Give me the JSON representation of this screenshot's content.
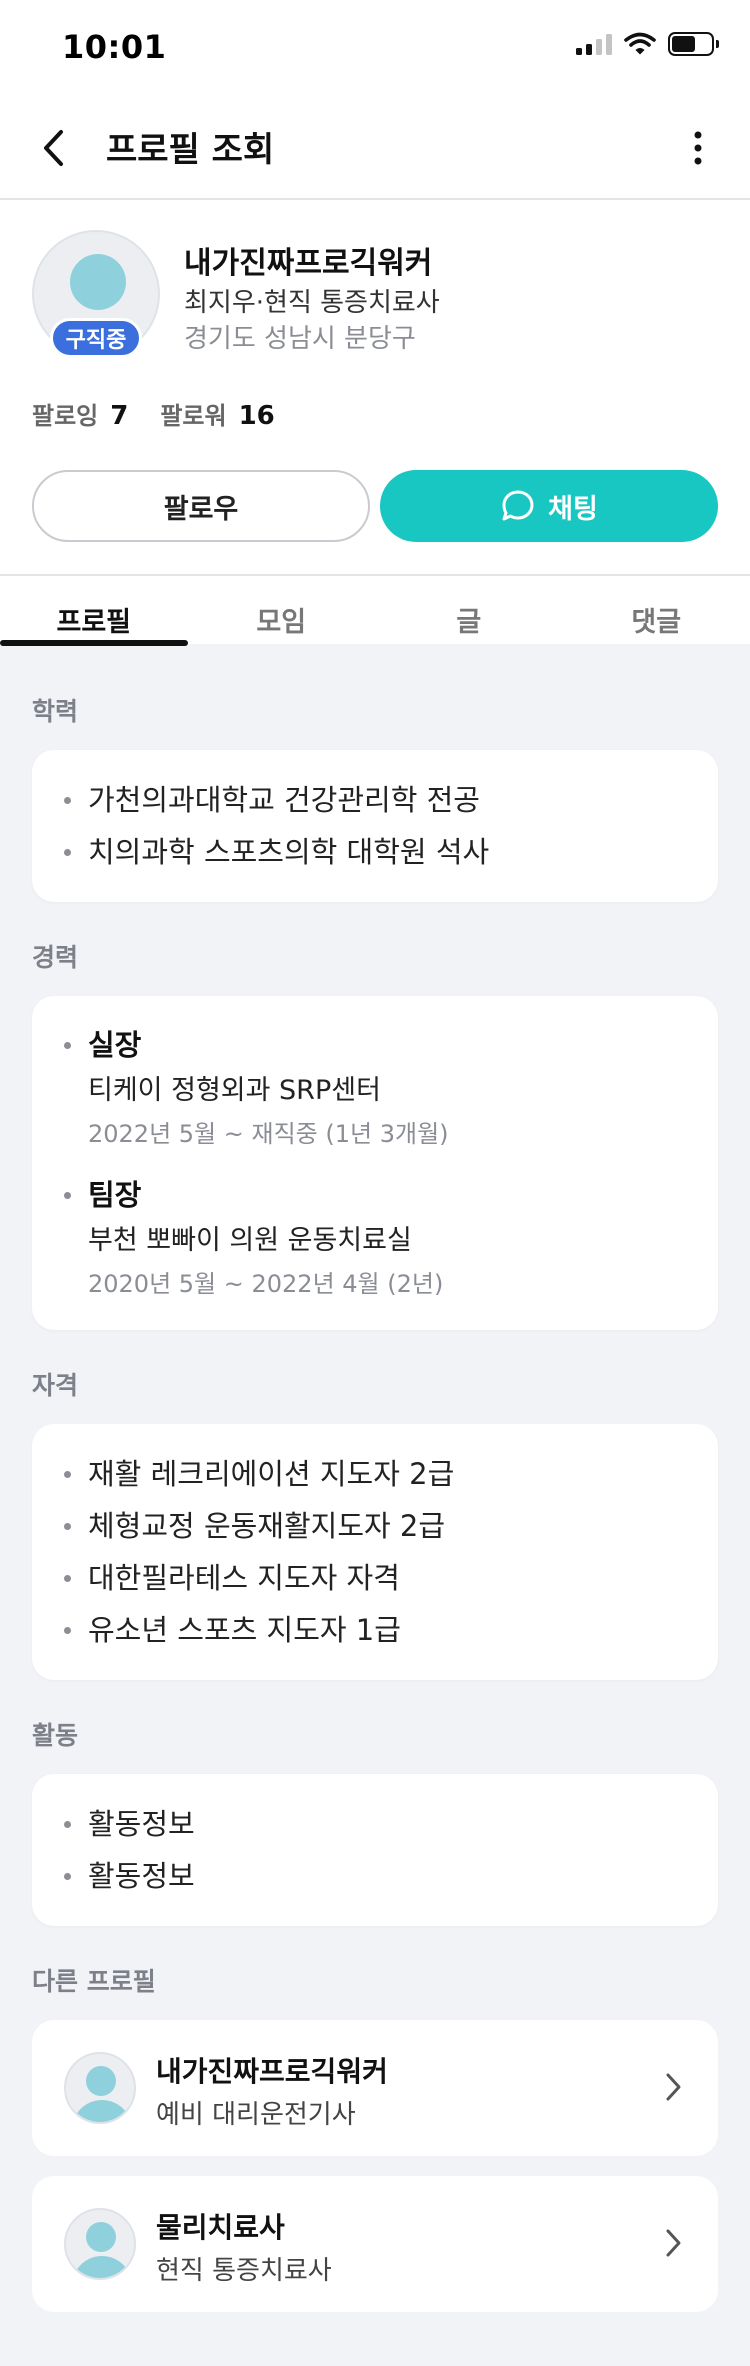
{
  "status_bar": {
    "time": "10:01"
  },
  "nav": {
    "title": "프로필 조회"
  },
  "profile": {
    "badge": "구직중",
    "nickname": "내가진짜프로긱워커",
    "role_line": "최지우·현직 통증치료사",
    "location": "경기도 성남시 분당구",
    "following_label": "팔로잉",
    "following_count": "7",
    "followers_label": "팔로워",
    "followers_count": "16",
    "follow_button": "팔로우",
    "chat_button": "채팅"
  },
  "tabs": [
    {
      "label": "프로필",
      "active": true
    },
    {
      "label": "모임",
      "active": false
    },
    {
      "label": "글",
      "active": false
    },
    {
      "label": "댓글",
      "active": false
    }
  ],
  "education": {
    "title": "학력",
    "items": [
      "가천의과대학교 건강관리학 전공",
      "치의과학 스포츠의학 대학원 석사"
    ]
  },
  "career": {
    "title": "경력",
    "items": [
      {
        "position": "실장",
        "org": "티케이 정형외과 SRP센터",
        "period": "2022년 5월 ~ 재직중 (1년 3개월)"
      },
      {
        "position": "팀장",
        "org": "부천 뽀빠이 의원 운동치료실",
        "period": "2020년 5월 ~ 2022년 4월 (2년)"
      }
    ]
  },
  "certificates": {
    "title": "자격",
    "items": [
      "재활 레크리에이션 지도자 2급",
      "체형교정 운동재활지도자 2급",
      "대한필라테스 지도자 자격",
      "유소년 스포츠 지도자 1급"
    ]
  },
  "activities": {
    "title": "활동",
    "items": [
      "활동정보",
      "활동정보"
    ]
  },
  "other_profiles": {
    "title": "다른 프로필",
    "items": [
      {
        "name": "내가진짜프로긱워커",
        "role": "예비 대리운전기사"
      },
      {
        "name": "물리치료사",
        "role": "현직 통증치료사"
      }
    ]
  },
  "colors": {
    "accent": "#19c7c2",
    "badge": "#3b6fde",
    "avatar": "#8ed1dd",
    "background": "#f2f3f6"
  },
  "icons": [
    "back-arrow-icon",
    "more-vertical-icon",
    "chat-bubble-icon",
    "chevron-right-icon",
    "signal-icon",
    "wifi-icon",
    "battery-icon"
  ]
}
